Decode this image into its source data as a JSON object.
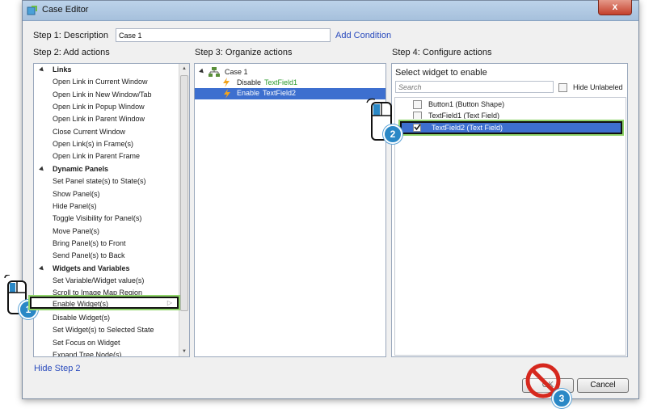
{
  "window": {
    "title": "Case Editor",
    "close_glyph": "x"
  },
  "step1": {
    "label": "Step 1: Description",
    "value": "Case 1",
    "add_condition": "Add Condition"
  },
  "step2": {
    "label": "Step 2: Add actions",
    "hide_link": "Hide Step 2",
    "items": [
      {
        "text": "Links",
        "group": true
      },
      {
        "text": "Open Link in Current Window"
      },
      {
        "text": "Open Link in New Window/Tab"
      },
      {
        "text": "Open Link in Popup Window"
      },
      {
        "text": "Open Link in Parent Window"
      },
      {
        "text": "Close Current Window"
      },
      {
        "text": "Open Link(s) in Frame(s)"
      },
      {
        "text": "Open Link in Parent Frame"
      },
      {
        "text": "Dynamic Panels",
        "group": true
      },
      {
        "text": "Set Panel state(s) to State(s)"
      },
      {
        "text": "Show Panel(s)"
      },
      {
        "text": "Hide Panel(s)"
      },
      {
        "text": "Toggle Visibility for Panel(s)"
      },
      {
        "text": "Move Panel(s)"
      },
      {
        "text": "Bring Panel(s) to Front"
      },
      {
        "text": "Send Panel(s) to Back"
      },
      {
        "text": "Widgets and Variables",
        "group": true
      },
      {
        "text": "Set Variable/Widget value(s)"
      },
      {
        "text": "Scroll to Image Map Region"
      },
      {
        "text": "Enable Widget(s)"
      },
      {
        "text": "Disable Widget(s)"
      },
      {
        "text": "Set Widget(s) to Selected State"
      },
      {
        "text": "Set Focus on Widget"
      },
      {
        "text": "Expand Tree Node(s)"
      }
    ]
  },
  "step3": {
    "label": "Step 3: Organize actions",
    "case_name": "Case 1",
    "actions": [
      {
        "verb": "Disable",
        "target": "TextField1"
      },
      {
        "verb": "Enable",
        "target": "TextField2"
      }
    ]
  },
  "step4": {
    "label": "Step 4: Configure actions",
    "heading": "Select widget to enable",
    "search_placeholder": "Search",
    "hide_unlabeled": "Hide Unlabeled",
    "widgets": [
      {
        "text": "Button1 (Button Shape)",
        "checked": false
      },
      {
        "text": "TextField1 (Text Field)",
        "checked": false
      },
      {
        "text": "TextField2 (Text Field)",
        "checked": true
      }
    ]
  },
  "buttons": {
    "ok": "OK",
    "cancel": "Cancel"
  },
  "callouts": [
    "1",
    "2",
    "3"
  ],
  "colors": {
    "selection": "#3d6fcf",
    "link": "#2a4bbd",
    "callout": "#2a88c6",
    "highlight_border": "#8fd46a",
    "target_green": "#5cb82a",
    "no_sign": "#d6281e"
  }
}
